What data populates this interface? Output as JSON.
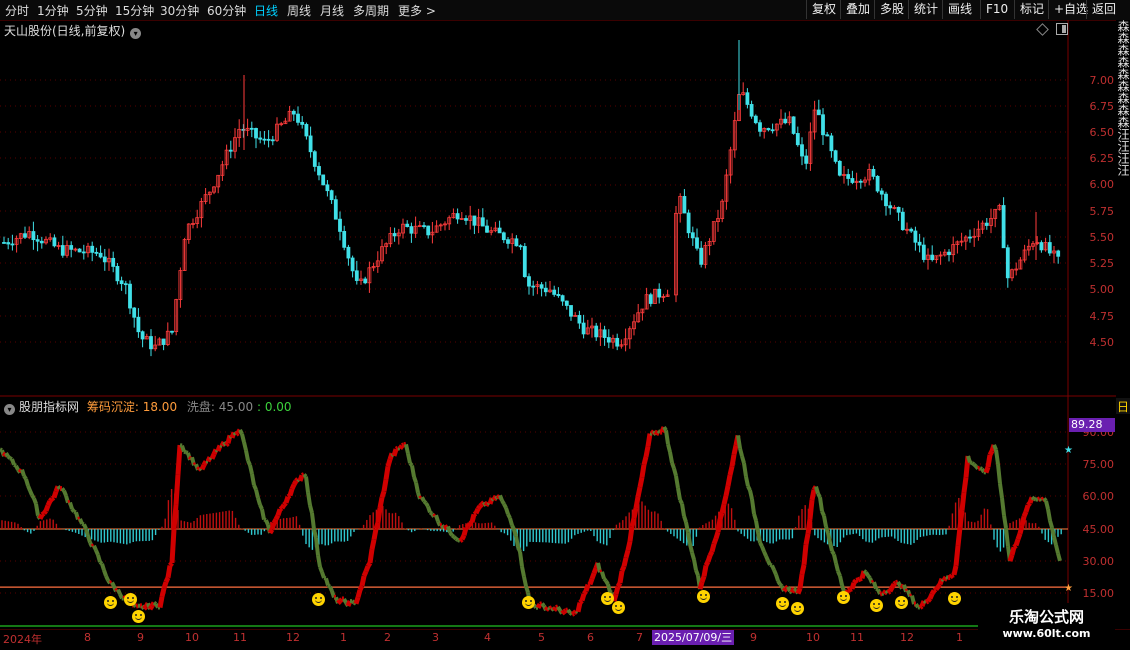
{
  "toolbar": {
    "periods": [
      "分时",
      "1分钟",
      "5分钟",
      "15分钟",
      "30分钟",
      "60分钟",
      "日线",
      "周线",
      "月线",
      "多周期",
      "更多 >"
    ],
    "active_period": "日线",
    "right_buttons": [
      "复权",
      "叠加",
      "多股",
      "统计",
      "画线",
      "F10",
      "标记",
      "+自选",
      "返回"
    ]
  },
  "main_chart": {
    "title": "天山股份(日线,前复权)",
    "price_axis": [
      "7.00",
      "6.75",
      "6.50",
      "6.25",
      "6.00",
      "5.75",
      "5.50",
      "5.25",
      "5.00",
      "4.75",
      "4.50"
    ]
  },
  "indicator": {
    "name": "股朋指标网",
    "item1_label": "筹码沉淀:",
    "item1_value": "18.00",
    "item2_label": "洗盘:",
    "item2_value": "45.00",
    "item3_value": ": 0.00",
    "current_badge": "89.28",
    "axis": [
      "90.00",
      "75.00",
      "60.00",
      "45.00",
      "30.00",
      "15.00"
    ],
    "signal_count": 17
  },
  "date_axis": {
    "labels": [
      "2024年",
      "8",
      "9",
      "10",
      "11",
      "12",
      "1",
      "2",
      "3",
      "4",
      "5",
      "6",
      "7",
      "9",
      "10",
      "11",
      "12",
      "1"
    ],
    "selected_date": "2025/07/09/三"
  },
  "right_panel": {
    "top_text": "森森森森森森森森森汪汪汪汪",
    "mid_text": "日"
  },
  "watermark": {
    "line1": "乐淘公式网",
    "line2": "www.60lt.com"
  },
  "colors": {
    "up": "#ff3c3c",
    "down": "#40e0e8",
    "ind_red": "#c80000",
    "ind_green": "#4a7a2a",
    "accent": "#6a1fb0",
    "line_orange": "#ff7040"
  }
}
